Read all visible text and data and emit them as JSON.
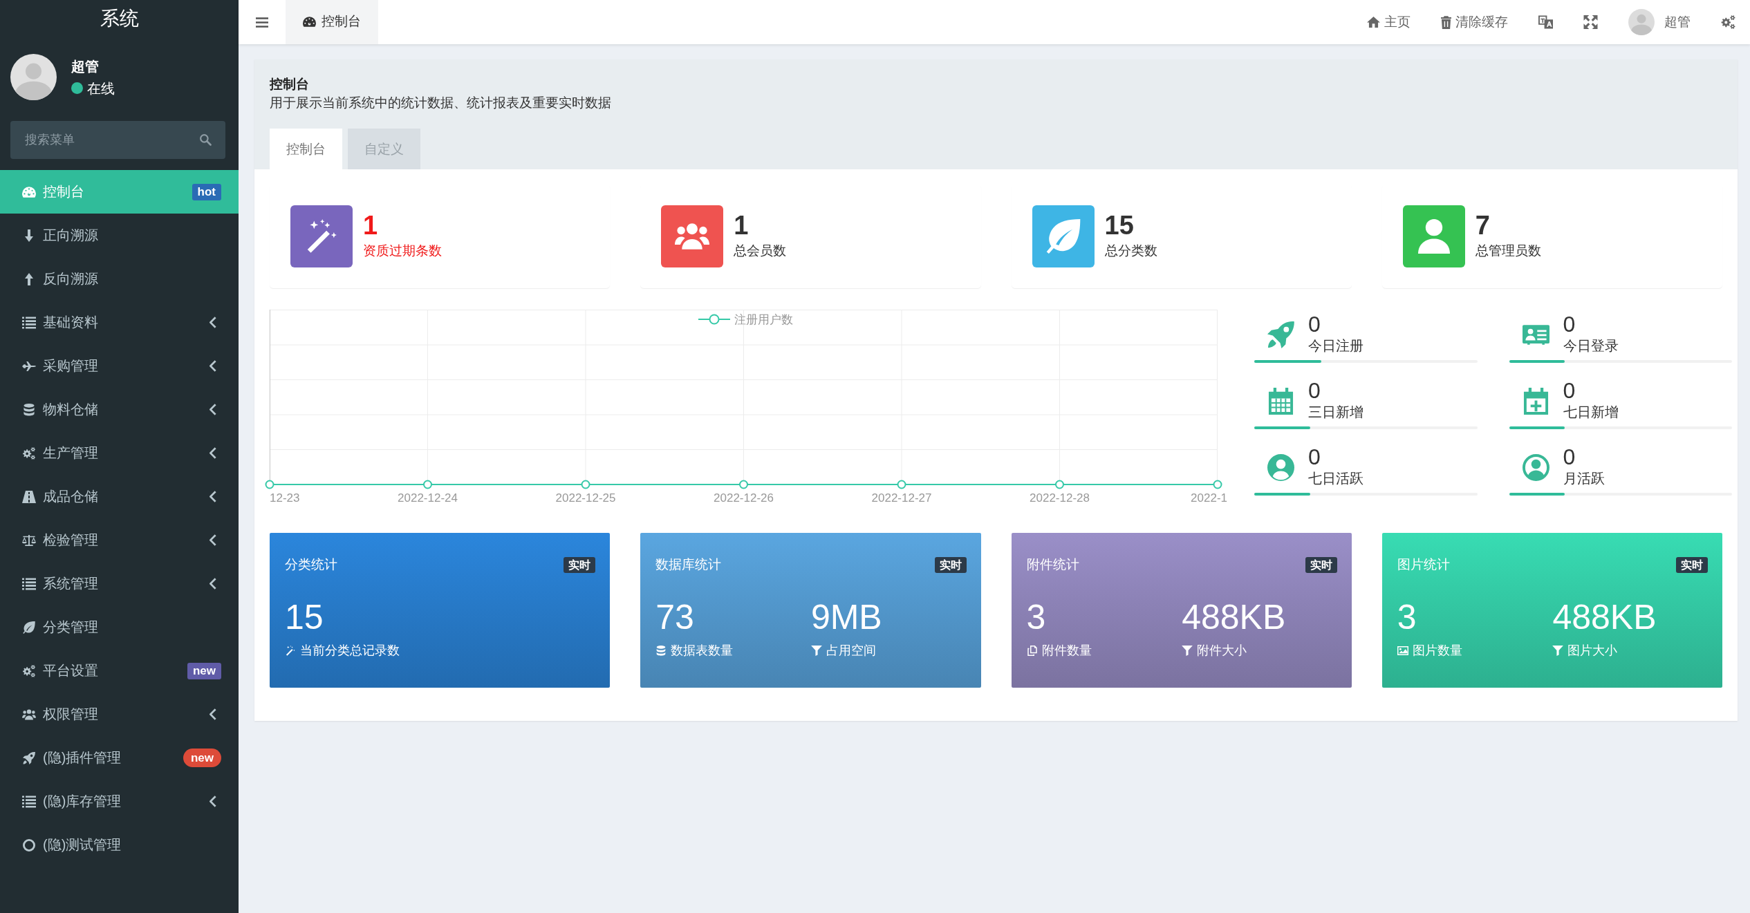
{
  "sidebar": {
    "title": "系统",
    "user": {
      "name": "超管",
      "status": "在线"
    },
    "search": {
      "placeholder": "搜索菜单"
    },
    "items": [
      {
        "label": "控制台",
        "selected": true,
        "kind": "link",
        "badge": {
          "text": "hot",
          "kind": "label",
          "color": "#2a6bb5"
        }
      },
      {
        "label": "正向溯源",
        "selected": false,
        "kind": "link"
      },
      {
        "label": "反向溯源",
        "selected": false,
        "kind": "link"
      },
      {
        "label": "基础资料",
        "selected": false,
        "kind": "tree"
      },
      {
        "label": "采购管理",
        "selected": false,
        "kind": "tree"
      },
      {
        "label": "物料仓储",
        "selected": false,
        "kind": "tree"
      },
      {
        "label": "生产管理",
        "selected": false,
        "kind": "tree"
      },
      {
        "label": "成品仓储",
        "selected": false,
        "kind": "tree"
      },
      {
        "label": "检验管理",
        "selected": false,
        "kind": "tree"
      },
      {
        "label": "系统管理",
        "selected": false,
        "kind": "tree"
      },
      {
        "label": "分类管理",
        "selected": false,
        "kind": "link"
      },
      {
        "label": "平台设置",
        "selected": false,
        "kind": "link",
        "badge": {
          "text": "new",
          "kind": "label",
          "color": "#605ca8"
        }
      },
      {
        "label": "权限管理",
        "selected": false,
        "kind": "tree"
      },
      {
        "label": "(隐)插件管理",
        "selected": false,
        "kind": "link",
        "badge": {
          "text": "new",
          "kind": "pill",
          "color": "#dd4b39"
        }
      },
      {
        "label": "(隐)库存管理",
        "selected": false,
        "kind": "tree"
      },
      {
        "label": "(隐)测试管理",
        "selected": false,
        "kind": "link"
      }
    ]
  },
  "topbar": {
    "tabs": [
      {
        "label": "控制台",
        "selected": true
      }
    ],
    "links": [
      {
        "label": "主页"
      },
      {
        "label": "清除缓存"
      }
    ],
    "user": {
      "name": "超管"
    }
  },
  "page": {
    "title": "控制台",
    "description": "用于展示当前系统中的统计数据、统计报表及重要实时数据",
    "tabs": [
      {
        "label": "控制台",
        "selected": true
      },
      {
        "label": "自定义",
        "selected": false
      }
    ]
  },
  "stat_cards": [
    {
      "value": "1",
      "label": "资质过期条数",
      "color": "#7966bd",
      "alert": true
    },
    {
      "value": "1",
      "label": "总会员数",
      "color": "#ef5350",
      "alert": false
    },
    {
      "value": "15",
      "label": "总分类数",
      "color": "#3eb5e5",
      "alert": false
    },
    {
      "value": "7",
      "label": "总管理员数",
      "color": "#35c252",
      "alert": false
    }
  ],
  "chart": {
    "legend": "注册用户数",
    "x_labels": [
      "12-23",
      "2022-12-24",
      "2022-12-25",
      "2022-12-26",
      "2022-12-27",
      "2022-12-28",
      "2022-1"
    ]
  },
  "quick_stats": [
    {
      "value": "0",
      "label": "今日注册",
      "level": 0.3
    },
    {
      "value": "0",
      "label": "今日登录",
      "level": 0.25
    },
    {
      "value": "0",
      "label": "三日新增",
      "level": 0.25
    },
    {
      "value": "0",
      "label": "七日新增",
      "level": 0.25
    },
    {
      "value": "0",
      "label": "七日活跃",
      "level": 0.25
    },
    {
      "value": "0",
      "label": "月活跃",
      "level": 0.25
    }
  ],
  "summary_cards": [
    {
      "title": "分类统计",
      "badge": "实时",
      "color": "#2b86dc",
      "metrics": [
        {
          "value": "15",
          "label": "当前分类总记录数"
        }
      ]
    },
    {
      "title": "数据库统计",
      "badge": "实时",
      "color": "#5aa6e0",
      "metrics": [
        {
          "value": "73",
          "label": "数据表数量"
        },
        {
          "value": "9MB",
          "label": "占用空间"
        }
      ]
    },
    {
      "title": "附件统计",
      "badge": "实时",
      "color": "#9a8fc8",
      "metrics": [
        {
          "value": "3",
          "label": "附件数量"
        },
        {
          "value": "488KB",
          "label": "附件大小"
        }
      ]
    },
    {
      "title": "图片统计",
      "badge": "实时",
      "color": "#38dcb3",
      "metrics": [
        {
          "value": "3",
          "label": "图片数量"
        },
        {
          "value": "488KB",
          "label": "图片大小"
        }
      ]
    }
  ]
}
